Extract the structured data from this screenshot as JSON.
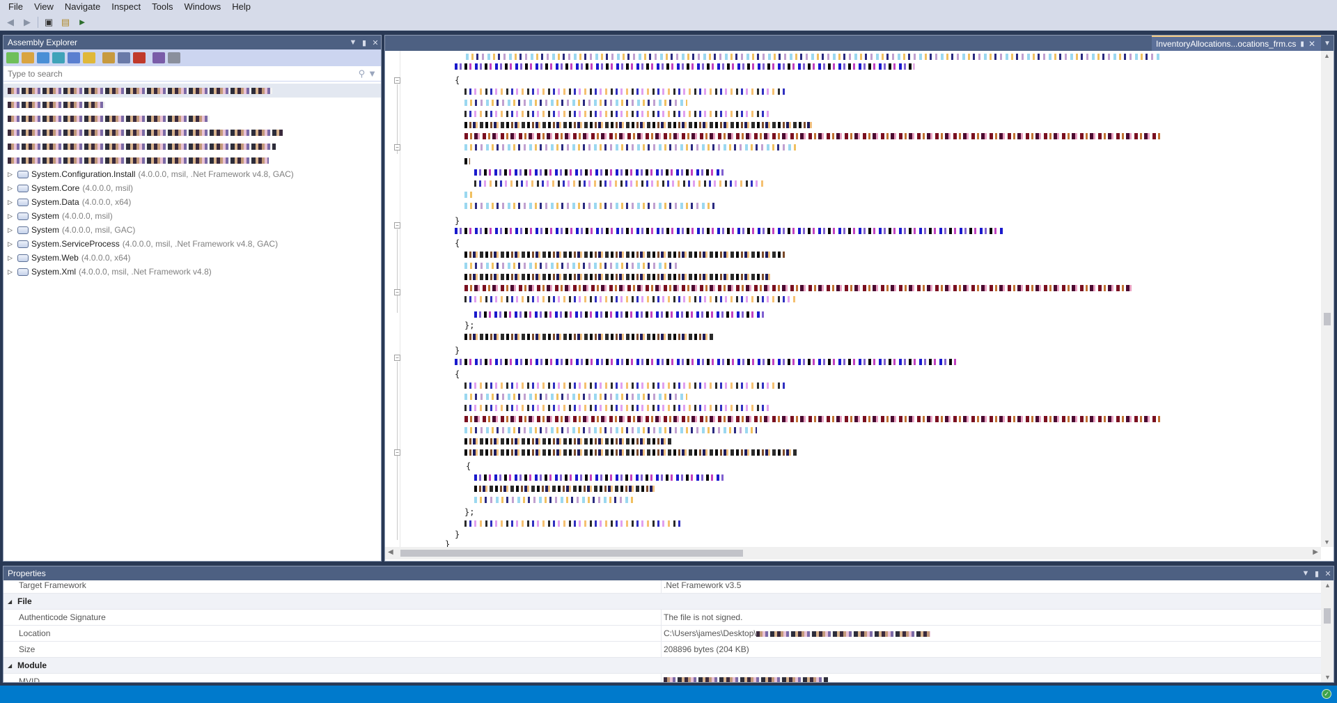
{
  "menu": [
    "File",
    "View",
    "Navigate",
    "Inspect",
    "Tools",
    "Windows",
    "Help"
  ],
  "toolbar": {
    "icons": [
      "back-arrow-icon",
      "forward-arrow-icon",
      "open-icon",
      "assembly-list-icon",
      "run-icon"
    ]
  },
  "assembly_explorer": {
    "title": "Assembly Explorer",
    "search_placeholder": "Type to search",
    "items": [
      {
        "name": "System.Configuration.Install",
        "meta": "(4.0.0.0, msil, .Net Framework v4.8, GAC)"
      },
      {
        "name": "System.Core",
        "meta": "(4.0.0.0, msil)"
      },
      {
        "name": "System.Data",
        "meta": "(4.0.0.0, x64)"
      },
      {
        "name": "System",
        "meta": "(4.0.0.0, msil)"
      },
      {
        "name": "System",
        "meta": "(4.0.0.0, msil, GAC)"
      },
      {
        "name": "System.ServiceProcess",
        "meta": "(4.0.0.0, msil, .Net Framework v4.8, GAC)"
      },
      {
        "name": "System.Web",
        "meta": "(4.0.0.0, x64)"
      },
      {
        "name": "System.Xml",
        "meta": "(4.0.0.0, msil, .Net Framework v4.8)"
      }
    ]
  },
  "editor": {
    "tab_title": "InventoryAllocations...ocations_frm.cs",
    "braces": {
      "open": "{",
      "close": "}",
      "close_semi": "};"
    }
  },
  "properties": {
    "title": "Properties",
    "rows": [
      {
        "type": "prop",
        "key": "Target Framework",
        "value": ".Net Framework v3.5"
      },
      {
        "type": "category",
        "key": "File"
      },
      {
        "type": "prop",
        "key": "Authenticode Signature",
        "value": "The file is not signed."
      },
      {
        "type": "prop",
        "key": "Location",
        "value": "C:\\Users\\james\\Desktop\\"
      },
      {
        "type": "prop",
        "key": "Size",
        "value": "208896 bytes (204 KB)"
      },
      {
        "type": "category",
        "key": "Module"
      },
      {
        "type": "prop",
        "key": "MVID",
        "value": ""
      }
    ]
  },
  "colors": {
    "frame": "#293955",
    "title_bar": "#4d6082",
    "menubar": "#d6dbe9",
    "status_bar": "#007acc"
  }
}
